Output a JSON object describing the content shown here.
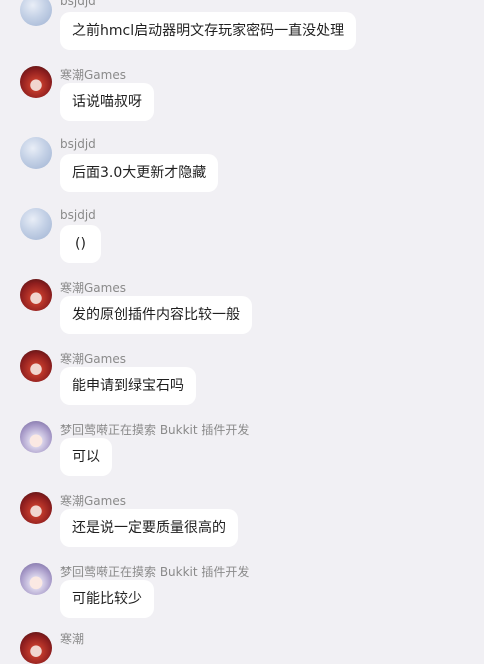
{
  "messages": [
    {
      "sender": "bsjdjd",
      "text": "之前hmcl启动器明文存玩家密码一直没处理",
      "avatar": "sky-avatar"
    },
    {
      "sender": "寒潮Games",
      "text": "话说喵叔呀",
      "avatar": "red-hair-avatar"
    },
    {
      "sender": "bsjdjd",
      "text": "后面3.0大更新才隐藏",
      "avatar": "sky-avatar"
    },
    {
      "sender": "bsjdjd",
      "text": "()",
      "avatar": "sky-avatar"
    },
    {
      "sender": "寒潮Games",
      "text": "发的原创插件内容比较一般",
      "avatar": "red-hair-avatar"
    },
    {
      "sender": "寒潮Games",
      "text": "能申请到绿宝石吗",
      "avatar": "red-hair-avatar"
    },
    {
      "sender": "梦回莺啭正在摸索 Bukkit 插件开发",
      "text": "可以",
      "avatar": "anime-avatar"
    },
    {
      "sender": "寒潮Games",
      "text": "还是说一定要质量很高的",
      "avatar": "red-hair-avatar"
    },
    {
      "sender": "梦回莺啭正在摸索 Bukkit 插件开发",
      "text": "可能比较少",
      "avatar": "anime-avatar"
    },
    {
      "sender": "寒潮",
      "text": "",
      "avatar": "red-hair-avatar"
    }
  ],
  "colors": {
    "background": "#f1f0f4",
    "bubble": "#ffffff",
    "sender_text": "#8a8a8a",
    "message_text": "#1f1f1f"
  }
}
